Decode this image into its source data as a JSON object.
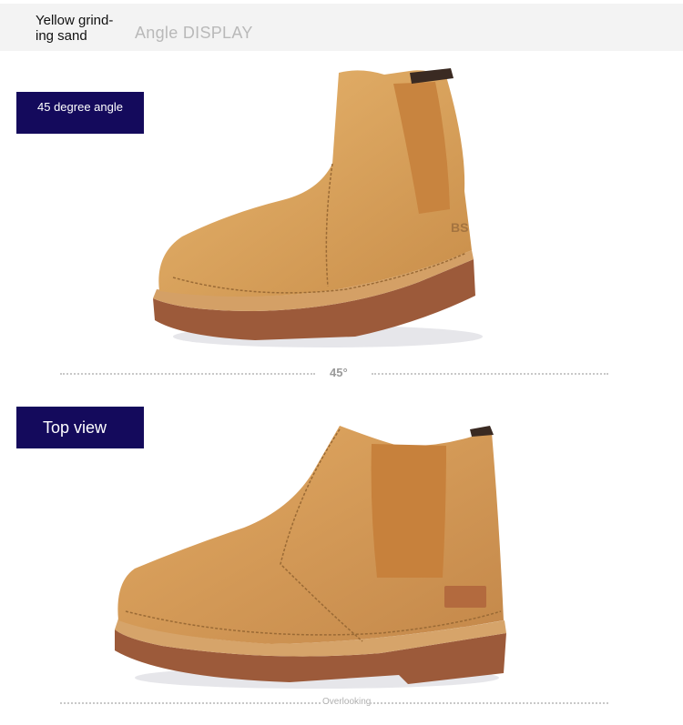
{
  "header": {
    "product_name": "Yellow grind-ing sand",
    "title": "Angle DISPLAY"
  },
  "views": [
    {
      "label": "45 degree angle",
      "caption": "45°"
    },
    {
      "label": "Top view",
      "caption": "Overlooking"
    }
  ],
  "colors": {
    "label_bg": "#140a5c",
    "leather": "#d9a25c",
    "sole": "#9c5a3a"
  }
}
